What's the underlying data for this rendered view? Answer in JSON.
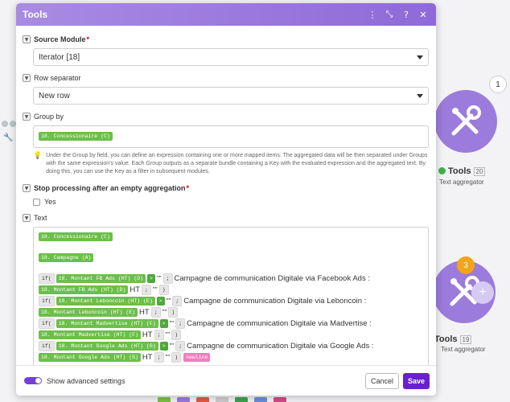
{
  "dialog": {
    "title": "Tools",
    "header_icons": [
      "more-icon",
      "expand-icon",
      "help-icon",
      "close-icon"
    ],
    "header_glyphs": {
      "more": "⋮",
      "expand": "⤡",
      "help": "?",
      "close": "✕"
    }
  },
  "source_module": {
    "label": "Source Module",
    "required_mark": "*",
    "value": "Iterator [18]"
  },
  "row_separator": {
    "label": "Row separator",
    "value": "New row"
  },
  "group_by": {
    "label": "Group by",
    "pill": "18. Concessionaire (C)",
    "hint": "Under the Group by field, you can define an expression containing one or more mapped items. The aggregated data will be then separated under Groups with the same expression's value. Each Group outputs as a separate bundle containing a Key with the evaluated expression and the aggregated text. By doing this, you can use the Key as a filter in subsequent modules."
  },
  "stop_processing": {
    "label": "Stop processing after an empty aggregation",
    "required_mark": "*",
    "option": "Yes"
  },
  "text": {
    "label": "Text",
    "line1": "18. Concessionaire (C)",
    "line2": "18. Campagne (A)",
    "if_kw": "if(",
    "gt": ">",
    "quotes": "\"\"",
    "semicolon": ";",
    "close_paren": ")",
    "ht": "HT",
    "newline": "newline",
    "rows": [
      {
        "field": "18. Montant FB Ads (HT) (D)",
        "label": "Campagne de communication Digitale via Facebook Ads :",
        "field2": "18. Montant FB Ads (HT) (D)"
      },
      {
        "field": "18. Montant Leboncoin (HT) (E)",
        "label": "Campagne de communication Digitale via Leboncoin :",
        "field2": "18. Montant Leboncoin (HT) (E)"
      },
      {
        "field": "18. Montant Madvertise (HT) (F)",
        "label": "Campagne de communication Digitale via Madvertise :",
        "field2": "18. Montant Madvertise (HT) (F)"
      },
      {
        "field": "18. Montant Google Ads (HT) (G)",
        "label": "Campagne de communication Digitale via Google Ads :",
        "field2": "18. Montant Google Ads (HT) (G)"
      }
    ]
  },
  "footer": {
    "advanced_label": "Show advanced settings",
    "cancel": "Cancel",
    "save": "Save"
  },
  "background": {
    "node1_title": "Tools",
    "node1_num": "20",
    "node1_sub": "Text aggregator",
    "node1_counter": "1",
    "node2_title": "Tools",
    "node2_num": "19",
    "node2_sub": "Text aggregator",
    "node2_counter": "3",
    "plus": "+"
  },
  "colors": {
    "header": "#9b7bdc",
    "pill_green": "#6cbf4a",
    "save": "#6a1fd0",
    "toggle": "#7340d6",
    "newline_pill": "#ef7fbf",
    "node": "#9b7bdc",
    "counter_orange": "#f2a41b"
  }
}
